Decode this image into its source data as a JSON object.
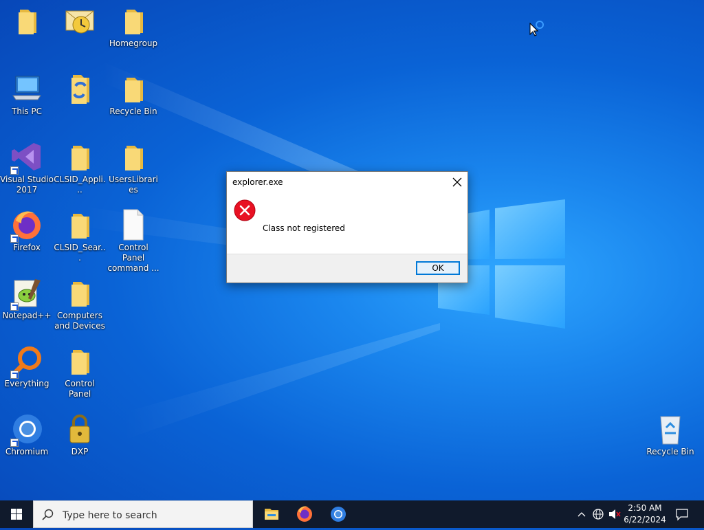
{
  "desktop": {
    "icons": [
      {
        "id": "folder-top-1",
        "label": ""
      },
      {
        "id": "outlook-express",
        "label": ""
      },
      {
        "id": "homegroup",
        "label": "Homegroup"
      },
      {
        "id": "this-pc",
        "label": "This PC"
      },
      {
        "id": "folder-special",
        "label": ""
      },
      {
        "id": "recycle-bin-folder",
        "label": "Recycle Bin"
      },
      {
        "id": "visual-studio",
        "label": "Visual Studio 2017"
      },
      {
        "id": "clsid-appl",
        "label": "CLSID_Appli..."
      },
      {
        "id": "users-libraries",
        "label": "UsersLibraries"
      },
      {
        "id": "firefox",
        "label": "Firefox"
      },
      {
        "id": "clsid-sear",
        "label": "CLSID_Sear..."
      },
      {
        "id": "control-panel-command",
        "label": "Control Panel command ..."
      },
      {
        "id": "notepadpp",
        "label": "Notepad++"
      },
      {
        "id": "computers-devices",
        "label": "Computers and Devices"
      },
      {
        "id": "everything",
        "label": "Everything"
      },
      {
        "id": "control-panel",
        "label": "Control Panel"
      },
      {
        "id": "chromium",
        "label": "Chromium"
      },
      {
        "id": "dxp",
        "label": "DXP"
      },
      {
        "id": "recycle-bin",
        "label": "Recycle Bin"
      }
    ]
  },
  "dialog": {
    "title": "explorer.exe",
    "message": "Class not registered",
    "ok_label": "OK"
  },
  "taskbar": {
    "search_placeholder": "Type here to search",
    "time": "2:50 AM",
    "date": "6/22/2024",
    "apps": [
      "file-explorer-icon",
      "firefox-icon",
      "chromium-icon"
    ]
  },
  "colors": {
    "desktop_accent": "#0a63d6",
    "taskbar": "#101a2c",
    "dialog_button_border": "#0078d7",
    "error_red": "#e81123"
  }
}
